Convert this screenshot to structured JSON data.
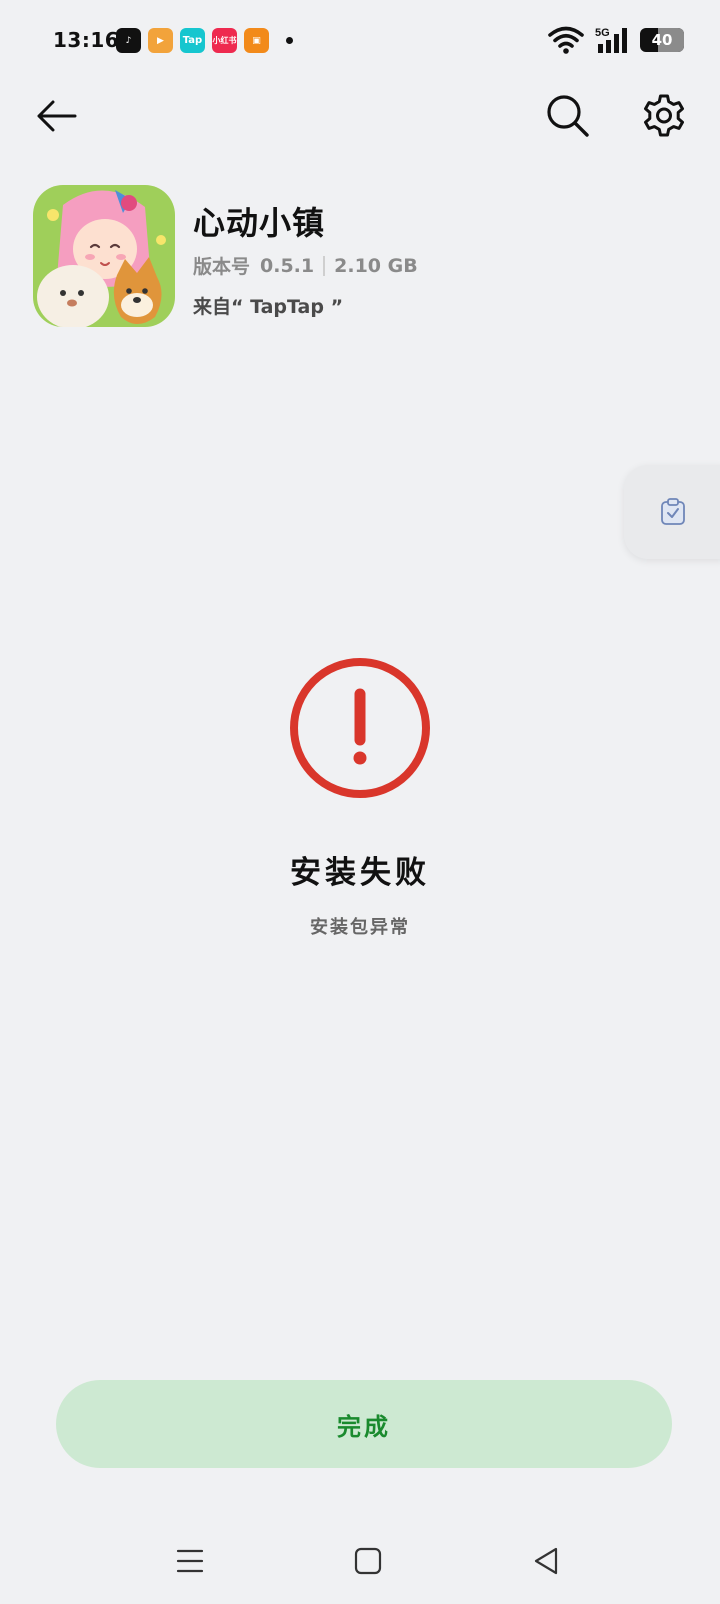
{
  "status_bar": {
    "time": "13:16",
    "notifications": [
      {
        "icon": "tiktok-icon",
        "label": "♪"
      },
      {
        "icon": "video-app-icon",
        "label": "▶"
      },
      {
        "icon": "taptap-icon",
        "label": "Tap"
      },
      {
        "icon": "xiaohongshu-icon",
        "label": "小红书"
      },
      {
        "icon": "orange-app-icon",
        "label": "▣"
      }
    ],
    "network": "5G",
    "battery_level": 40,
    "battery_text": "40"
  },
  "app": {
    "name": "心动小镇",
    "version_label": "版本号",
    "version": "0.5.1",
    "size": "2.10 GB",
    "source": "来自“ TapTap ”"
  },
  "result": {
    "title": "安装失败",
    "subtitle": "安装包异常",
    "color": "#d9362b"
  },
  "actions": {
    "done_label": "完成",
    "done_bg": "#cde9d2",
    "done_text_color": "#1a8a2e"
  },
  "icons": {
    "back": "back-arrow-icon",
    "search": "search-icon",
    "settings": "gear-icon",
    "side_tab": "clipboard-icon",
    "nav_menu": "menu-icon",
    "nav_home": "home-icon",
    "nav_back": "triangle-back-icon"
  }
}
